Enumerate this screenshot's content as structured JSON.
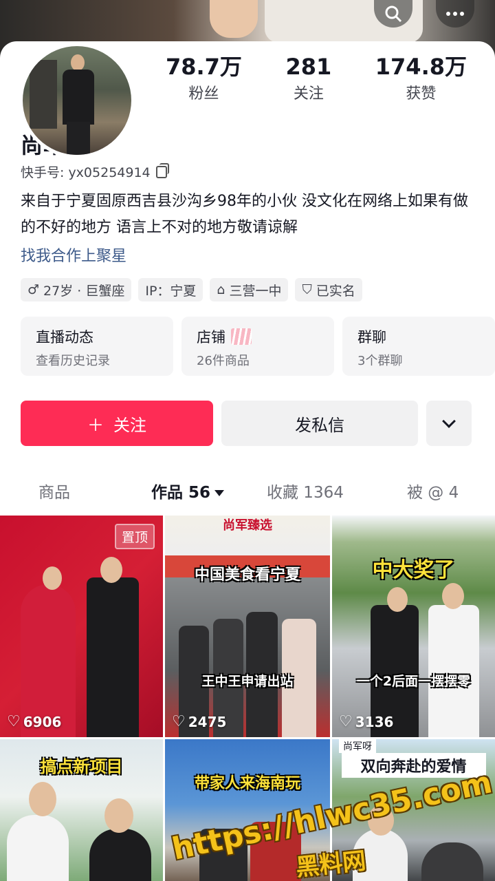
{
  "header": {
    "search_icon": "search-icon",
    "more_icon": "more-icon"
  },
  "profile": {
    "stats": [
      {
        "value": "78.7万",
        "label": "粉丝"
      },
      {
        "value": "281",
        "label": "关注"
      },
      {
        "value": "174.8万",
        "label": "获赞"
      }
    ],
    "name": "尚军呀",
    "kuaishou_id": "快手号: yx05254914",
    "bio": "来自于宁夏固原西吉县沙沟乡98年的小伙 没文化在网络上如果有做的不好的地方 语言上不对的地方敬请谅解",
    "bio_link": "找我合作上聚星",
    "tags": [
      {
        "icon": "♂",
        "label": "27岁 · 巨蟹座"
      },
      {
        "icon": "",
        "label": "IP：宁夏"
      },
      {
        "icon": "⌂",
        "label": "三营一中"
      },
      {
        "icon": "⛉",
        "label": "已实名"
      }
    ]
  },
  "cards": [
    {
      "title": "直播动态",
      "sub": "查看历史记录"
    },
    {
      "title": "店铺",
      "sub": "26件商品"
    },
    {
      "title": "群聊",
      "sub": "3个群聊"
    }
  ],
  "actions": {
    "follow_icon": "＋",
    "follow": "关注",
    "message": "发私信"
  },
  "tabs": {
    "products": "商品",
    "works": "作品 56",
    "favorites": "收藏 1364",
    "mentions": "被 @ 4"
  },
  "videos": [
    {
      "count": "6906",
      "pinned": "置顶",
      "overlay": ""
    },
    {
      "count": "2475",
      "pinned": "",
      "overlay_top": "中国美食看宁夏",
      "overlay": "王中王申请出站",
      "shop_sign": "尚军臻选"
    },
    {
      "count": "3136",
      "pinned": "",
      "overlay_top": "中大奖了",
      "overlay": "一个2后面一摆摆零"
    },
    {
      "count": "",
      "overlay_top": "搞点新项目"
    },
    {
      "count": "",
      "overlay_top": "带家人来海南玩"
    },
    {
      "count": "",
      "overlay_top": "双向奔赴的爱情",
      "corner": "尚军呀"
    }
  ],
  "watermark": {
    "url": "https://hlwc35.com",
    "brand": "黑料网"
  },
  "colors": {
    "accent": "#fe2c55",
    "link": "#3d5a8a"
  }
}
